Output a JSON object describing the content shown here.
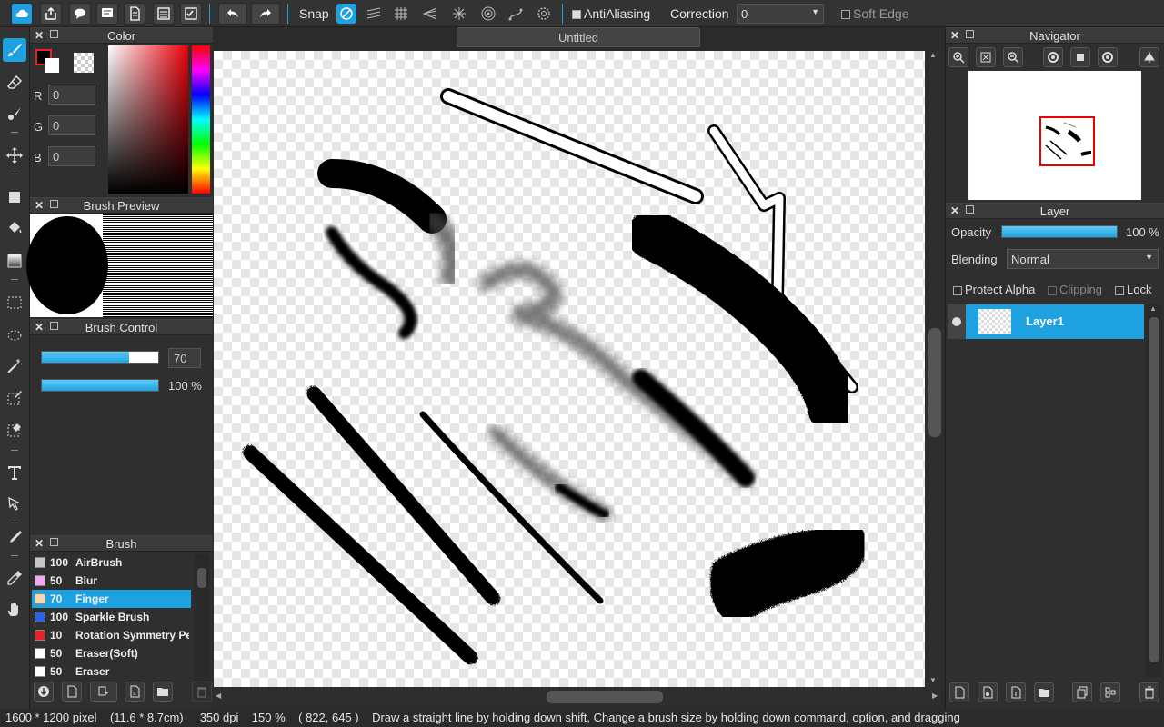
{
  "toolbar": {
    "snap_label": "Snap",
    "antialias_label": "AntiAliasing",
    "correction_label": "Correction",
    "correction_value": "0",
    "soft_edge_label": "Soft Edge"
  },
  "document": {
    "title": "Untitled"
  },
  "color_panel": {
    "title": "Color",
    "r_label": "R",
    "g_label": "G",
    "b_label": "B",
    "r_value": "0",
    "g_value": "0",
    "b_value": "0",
    "foreground": "#000000",
    "background": "#ffffff"
  },
  "brush_preview": {
    "title": "Brush Preview"
  },
  "brush_control": {
    "title": "Brush Control",
    "size_value": "70",
    "size_fraction": 0.75,
    "opacity_value": "100 %",
    "opacity_fraction": 1.0
  },
  "brush_panel": {
    "title": "Brush",
    "items": [
      {
        "size": "100",
        "name": "AirBrush",
        "color": "#c8c8c8"
      },
      {
        "size": "50",
        "name": "Blur",
        "color": "#f5a6f0"
      },
      {
        "size": "70",
        "name": "Finger",
        "color": "#f0d9b5",
        "selected": true
      },
      {
        "size": "100",
        "name": "Sparkle Brush",
        "color": "#2b63e8"
      },
      {
        "size": "10",
        "name": "Rotation Symmetry Pe",
        "color": "#e8242b"
      },
      {
        "size": "50",
        "name": "Eraser(Soft)",
        "color": "#ffffff"
      },
      {
        "size": "50",
        "name": "Eraser",
        "color": "#ffffff"
      }
    ]
  },
  "navigator": {
    "title": "Navigator"
  },
  "layer_panel": {
    "title": "Layer",
    "opacity_label": "Opacity",
    "opacity_value": "100 %",
    "blending_label": "Blending",
    "blending_value": "Normal",
    "protect_alpha_label": "Protect Alpha",
    "clipping_label": "Clipping",
    "lock_label": "Lock",
    "layers": [
      {
        "name": "Layer1"
      }
    ]
  },
  "status": {
    "size": "1600 * 1200 pixel",
    "physical": "(11.6 * 8.7cm)",
    "dpi": "350 dpi",
    "zoom": "150 %",
    "cursor": "( 822, 645 )",
    "hint": "Draw a straight line by holding down shift, Change a brush size by holding down command, option, and dragging"
  },
  "colors": {
    "accent": "#1da1e0",
    "panel": "#2f2f2f"
  }
}
